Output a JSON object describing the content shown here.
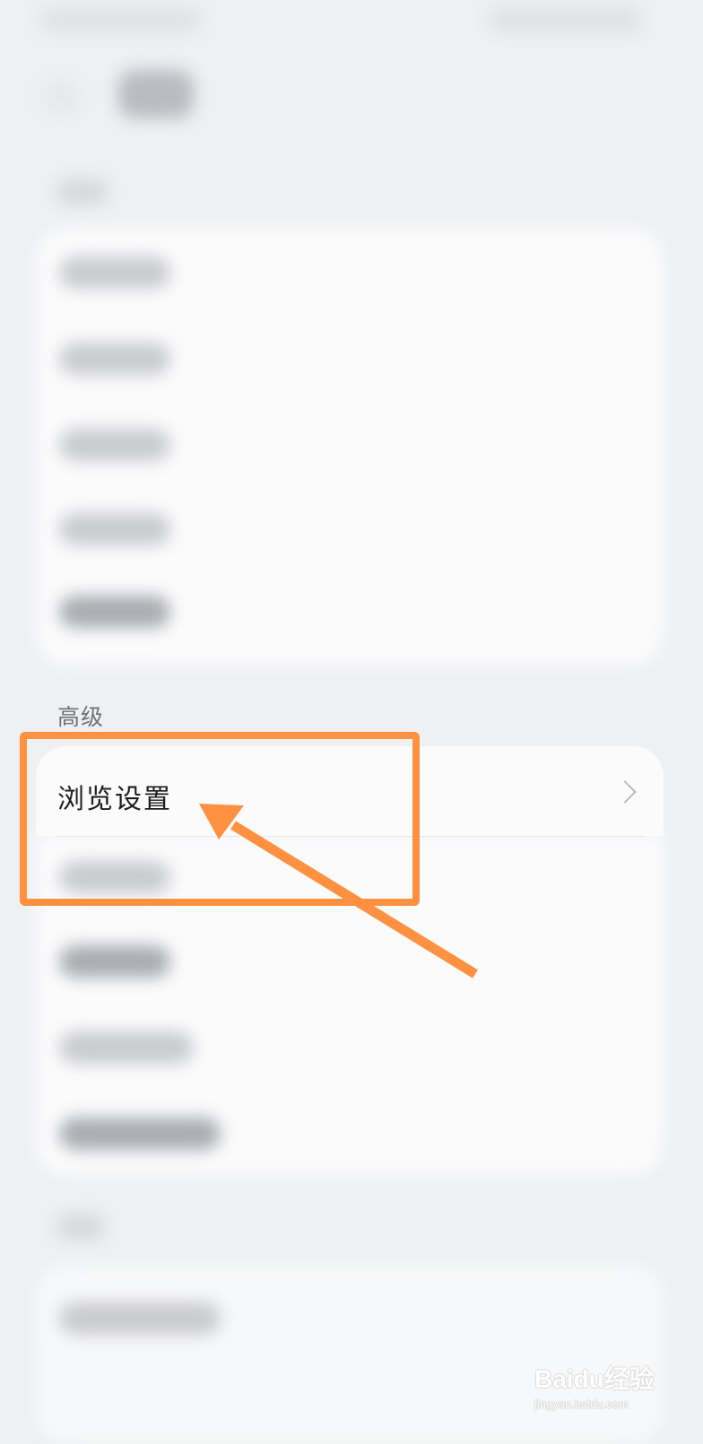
{
  "section": {
    "label": "高级"
  },
  "settings_item": {
    "label": "浏览设置",
    "icon": "chevron-right-icon"
  },
  "annotation": {
    "color": "#ff9140"
  },
  "watermark": {
    "brand": "Baidu经验",
    "url": "jingyan.baidu.com"
  }
}
